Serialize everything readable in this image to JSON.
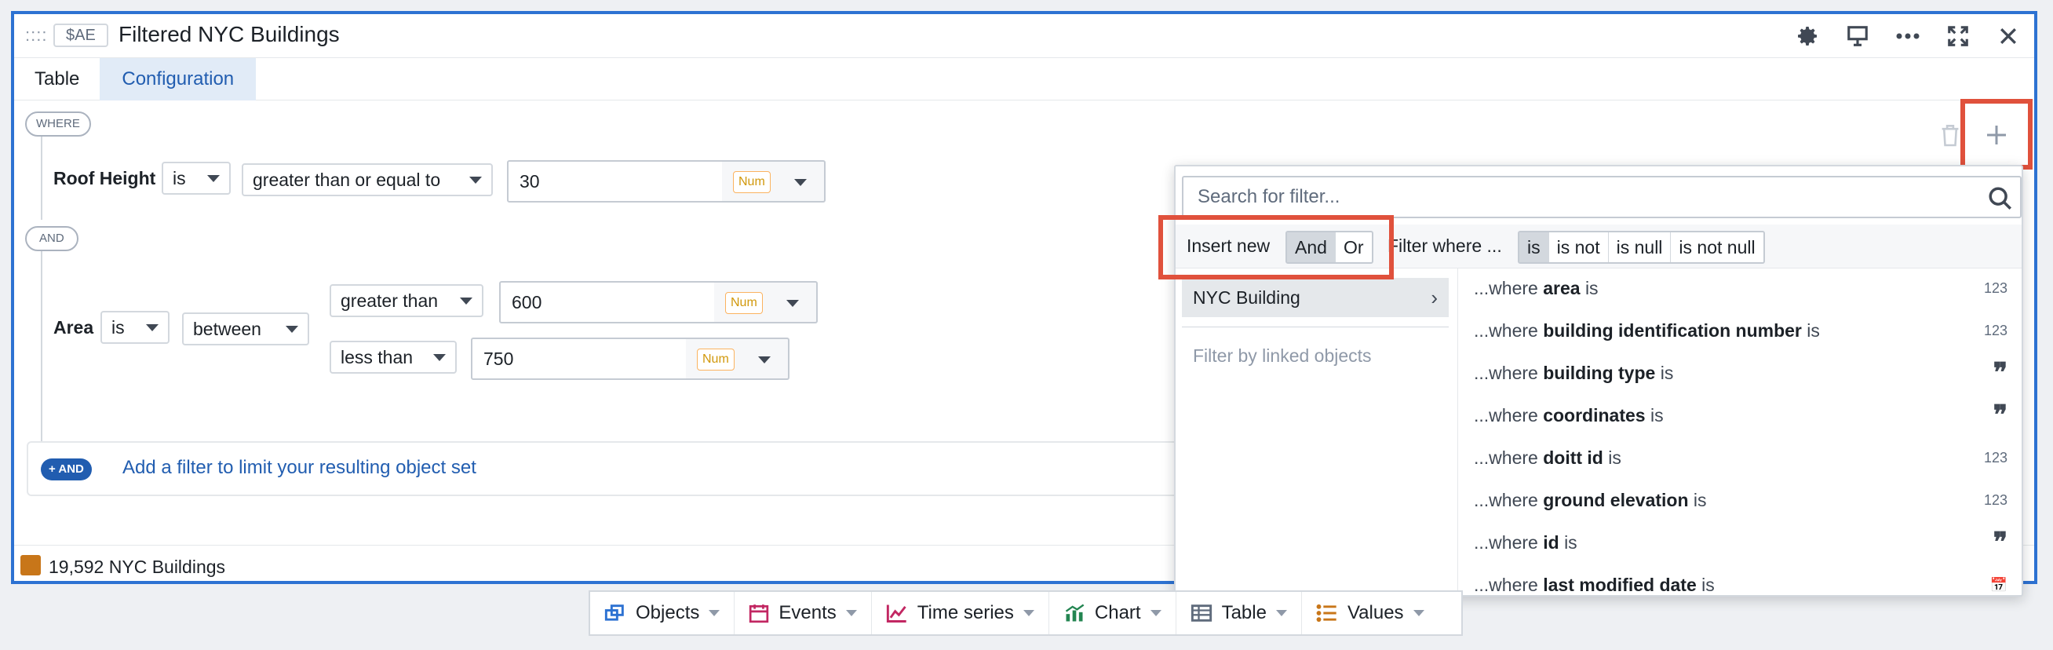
{
  "header": {
    "grip": "::::",
    "tag": "$AE",
    "title": "Filtered NYC Buildings"
  },
  "tabs": [
    {
      "label": "Table",
      "active": false
    },
    {
      "label": "Configuration",
      "active": true
    }
  ],
  "filter": {
    "where_label": "WHERE",
    "and_label": "AND",
    "rows": [
      {
        "property": "Roof Height",
        "op": "is",
        "comparator": "greater than or equal to",
        "value": "30",
        "type_tag": "Num"
      },
      {
        "property": "Area",
        "op": "is",
        "comparator": "between",
        "lower_op": "greater than",
        "lower_value": "600",
        "upper_op": "less than",
        "upper_value": "750",
        "type_tag": "Num"
      }
    ],
    "add_button": "+ AND",
    "add_text": "Add a filter to limit your resulting object set"
  },
  "footer": {
    "count": "19,592 NYC Buildings"
  },
  "popover": {
    "search_placeholder": "Search for filter...",
    "insert_label": "Insert new",
    "insert_options": [
      "And",
      "Or"
    ],
    "insert_selected": "And",
    "filter_where_label": "Filter where ...",
    "filter_ops": [
      "is",
      "is not",
      "is null",
      "is not null"
    ],
    "filter_op_selected": "is",
    "object_type": "NYC Building",
    "linked_label": "Filter by linked objects",
    "properties": [
      {
        "prefix": "...where",
        "name": "area",
        "suffix": "is",
        "type": "123"
      },
      {
        "prefix": "...where",
        "name": "building identification number",
        "suffix": "is",
        "type": "123"
      },
      {
        "prefix": "...where",
        "name": "building type",
        "suffix": "is",
        "type": "99"
      },
      {
        "prefix": "...where",
        "name": "coordinates",
        "suffix": "is",
        "type": "99"
      },
      {
        "prefix": "...where",
        "name": "doitt id",
        "suffix": "is",
        "type": "123"
      },
      {
        "prefix": "...where",
        "name": "ground elevation",
        "suffix": "is",
        "type": "123"
      },
      {
        "prefix": "...where",
        "name": "id",
        "suffix": "is",
        "type": "99"
      },
      {
        "prefix": "...where",
        "name": "last modified date",
        "suffix": "is",
        "type": "calendar"
      }
    ]
  },
  "bottombar": [
    {
      "icon": "objects-icon",
      "label": "Objects",
      "color": "#2d72d2"
    },
    {
      "icon": "events-icon",
      "label": "Events",
      "color": "#c22762"
    },
    {
      "icon": "time-series-icon",
      "label": "Time series",
      "color": "#c22762"
    },
    {
      "icon": "chart-icon",
      "label": "Chart",
      "color": "#238551"
    },
    {
      "icon": "table-icon",
      "label": "Table",
      "color": "#5f6b7c"
    },
    {
      "icon": "values-icon",
      "label": "Values",
      "color": "#c87619"
    }
  ]
}
